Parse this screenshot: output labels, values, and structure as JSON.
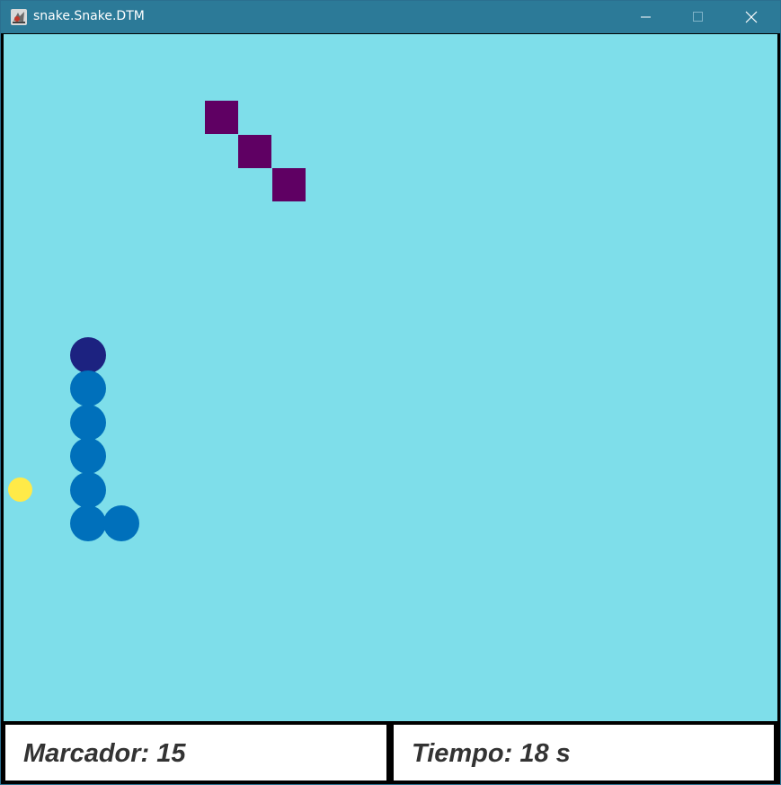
{
  "window": {
    "title": "snake.Snake.DTM",
    "icon": "java-app-icon",
    "controls": [
      "minimize-icon",
      "maximize-icon",
      "close-icon"
    ]
  },
  "colors": {
    "titlebar": "#2c7a98",
    "board": "#7edeea",
    "obstacle": "#5f0063",
    "snake_head": "#1c2280",
    "snake_body": "#0070bb",
    "food": "#ffea48"
  },
  "status": {
    "score_label": "Marcador:",
    "score_value": "15",
    "time_label": "Tiempo:",
    "time_value": "18",
    "time_unit": "s"
  }
}
